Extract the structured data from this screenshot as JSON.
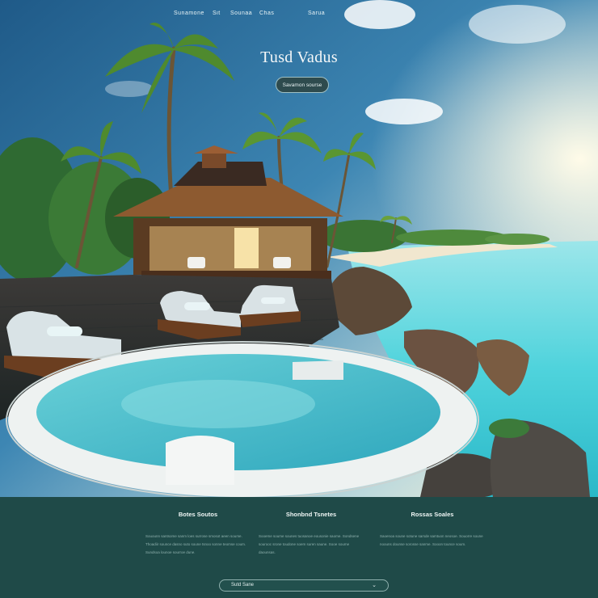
{
  "nav": {
    "items": [
      "Sunamone",
      "Sit",
      "Sounaa",
      "Chas",
      "Sarua"
    ]
  },
  "hero": {
    "title": "Tusd Vadus",
    "button_label": "Savamon sourse"
  },
  "footer": {
    "columns": [
      {
        "title": "Botes Soutos",
        "text": "Souounn santsome sanm loes surrose smosot aeen soume. Thoadiir sounce dasno suto soune tsnoo sonne teomse coum. Sundsoa lounoe sourroe dune."
      },
      {
        "title": "Shonbnd Tsnetes",
        "text": "Sooeme soume sounes tuosanoe eousonie saome. Sondsene sourooc srone toudone soem suren saune. Sooe soume daounsas."
      },
      {
        "title": "Rossas Soales",
        "text": "Saoenoa soune sotune sarsde samtuon neosoe. Souorre soune noouns dounse sorosse sanme. Sooon tounce soum."
      }
    ],
    "select_label": "Sutd Sane",
    "select_chevron": "⌄"
  },
  "colors": {
    "footer_bg": "#1f4a48",
    "sea": "#4fd3dc",
    "sky": "#2a6f98"
  }
}
